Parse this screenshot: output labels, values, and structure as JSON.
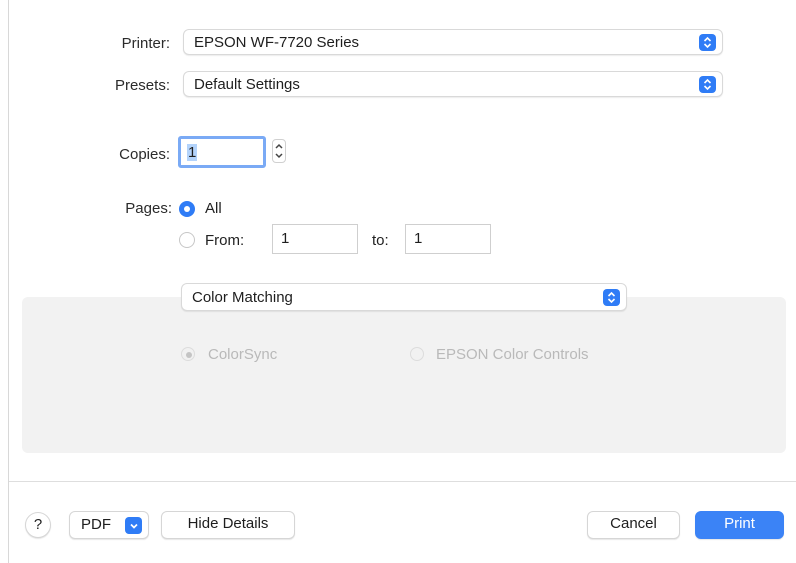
{
  "printer": {
    "label": "Printer:",
    "value": "EPSON WF-7720 Series"
  },
  "presets": {
    "label": "Presets:",
    "value": "Default Settings"
  },
  "copies": {
    "label": "Copies:",
    "value": "1"
  },
  "pages": {
    "label": "Pages:",
    "all_label": "All",
    "from_label": "From:",
    "from_value": "1",
    "to_label": "to:",
    "to_value": "1"
  },
  "section": {
    "selected": "Color Matching",
    "options": {
      "colorsync": "ColorSync",
      "epson": "EPSON Color Controls"
    }
  },
  "footer": {
    "help": "?",
    "pdf": "PDF",
    "hide_details": "Hide Details",
    "cancel": "Cancel",
    "print": "Print"
  },
  "colors": {
    "accent": "#2f7cf6",
    "panel": "#f2f2f2",
    "disabled_text": "#b9b9b9"
  }
}
